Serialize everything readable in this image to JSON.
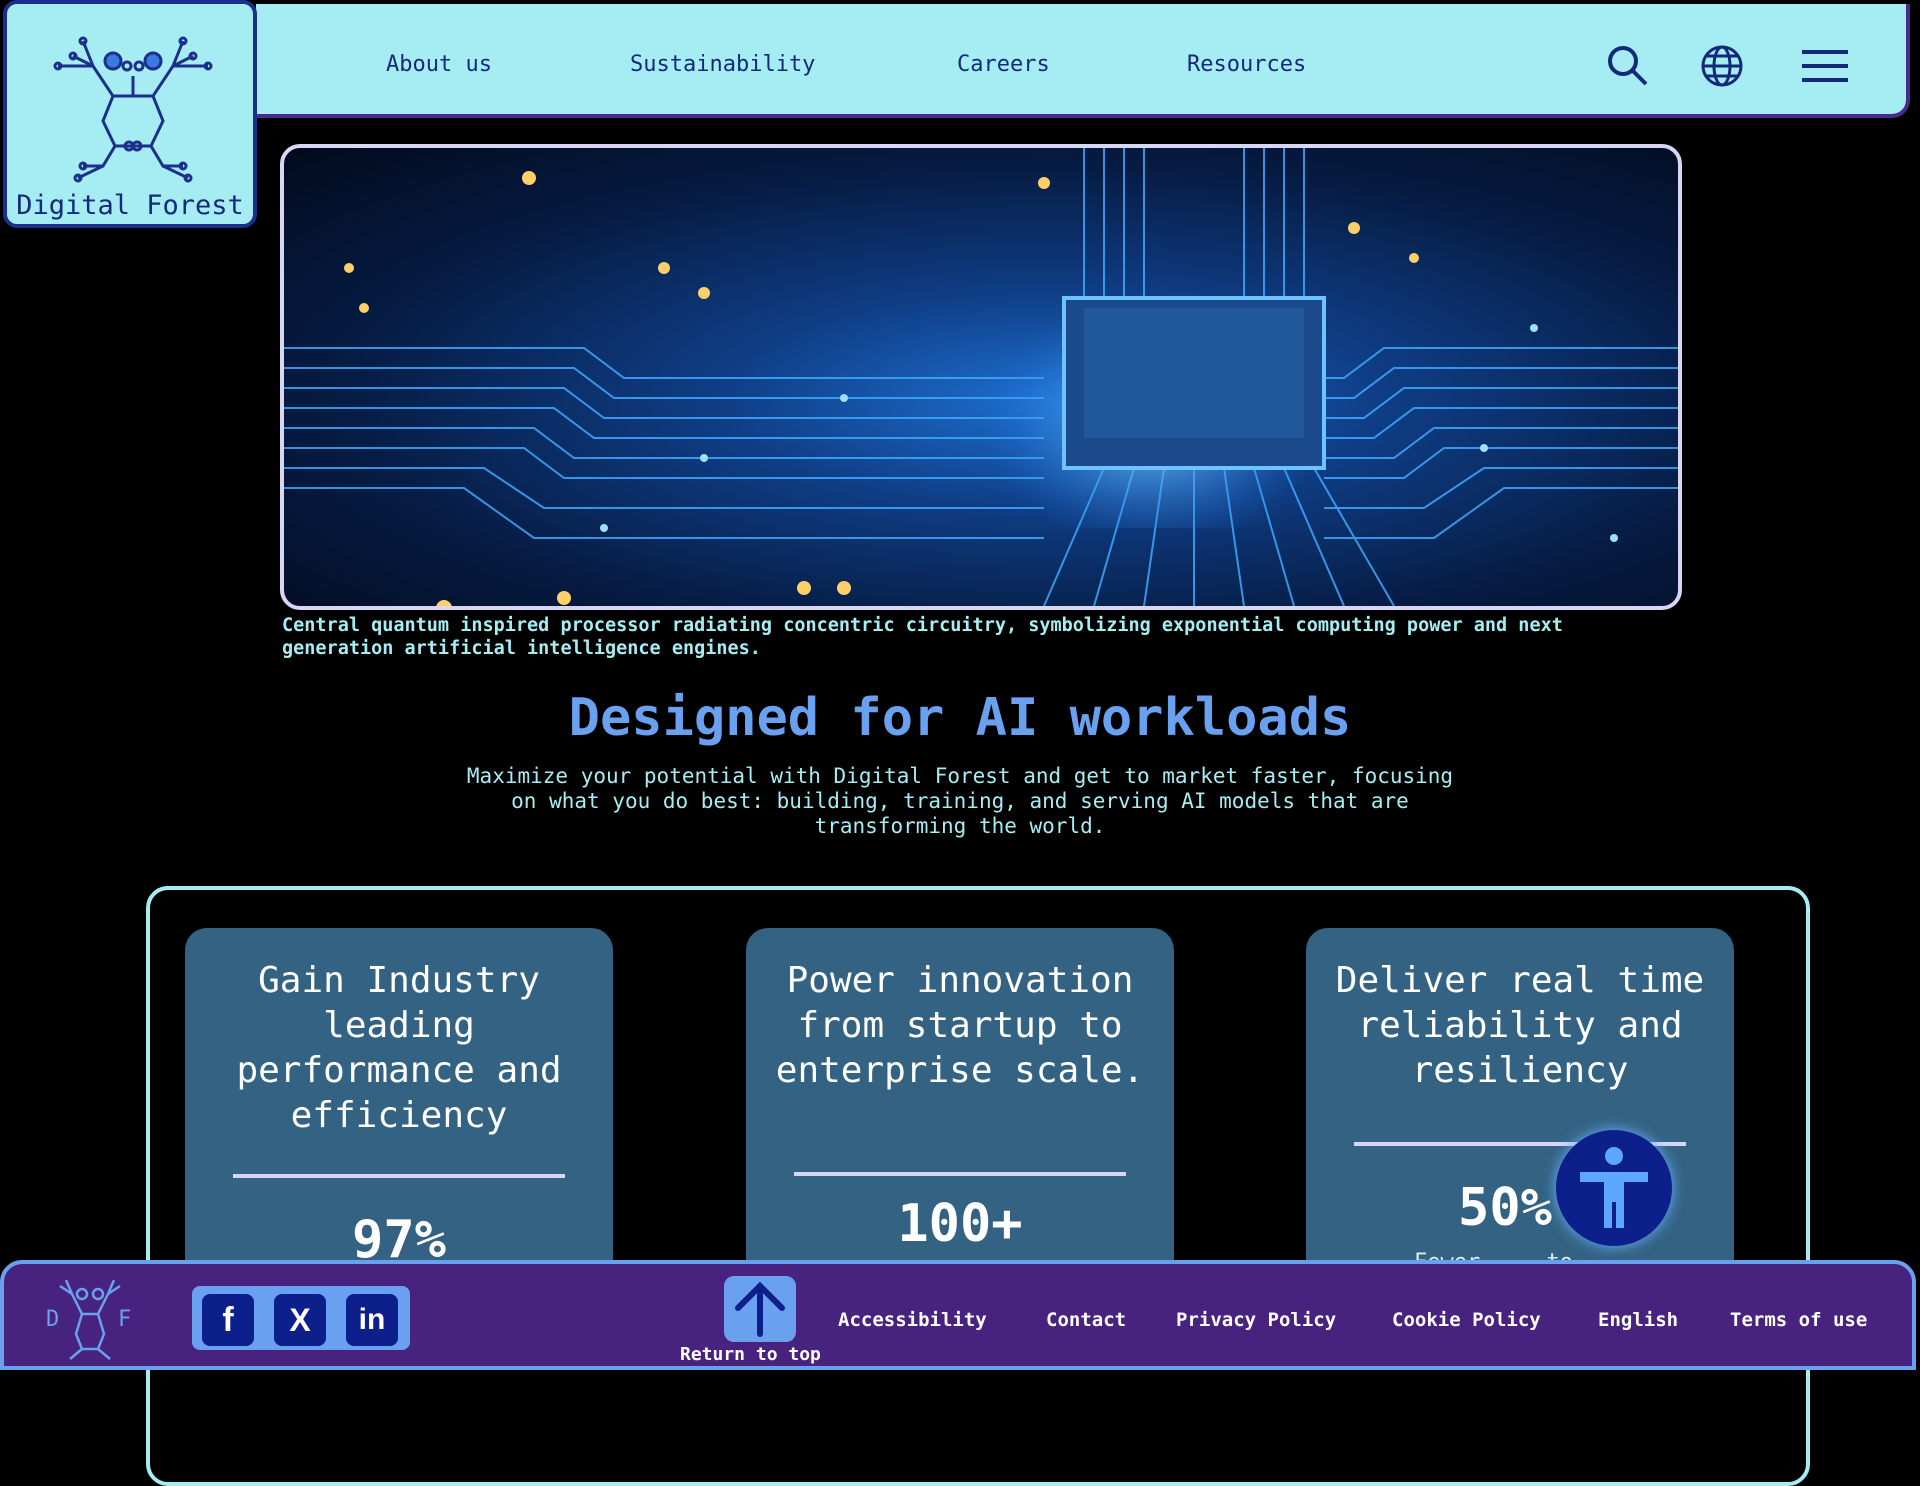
{
  "brand": {
    "name": "Digital Forest",
    "footer_initials": [
      "D",
      "F"
    ]
  },
  "nav": {
    "items": [
      {
        "label": "About us"
      },
      {
        "label": "Sustainability"
      },
      {
        "label": "Careers"
      },
      {
        "label": "Resources"
      }
    ],
    "icons": [
      "search-icon",
      "globe-icon",
      "hamburger-menu-icon"
    ]
  },
  "hero": {
    "image_alt": "circuit-board-processor-image",
    "caption": "Central quantum inspired processor radiating concentric circuitry, symbolizing exponential computing power and next generation artificial intelligence engines."
  },
  "section": {
    "title": "Designed for AI workloads",
    "description": "Maximize your potential with Digital Forest and get to market faster, focusing on what you do best: building, training, and serving AI models that are transforming the world."
  },
  "cards": [
    {
      "title": "Gain Industry leading performance and efficiency",
      "stat": "97%",
      "sub": ""
    },
    {
      "title": "Power innovation from startup to enterprise scale.",
      "stat": "100+",
      "sub": ""
    },
    {
      "title": "Deliver real time reliability and resiliency",
      "stat": "50%",
      "sub": "Fewer ... to ..."
    }
  ],
  "footer": {
    "social": [
      {
        "label": "f",
        "icon": "facebook-icon"
      },
      {
        "label": "X",
        "icon": "x-icon"
      },
      {
        "label": "in",
        "icon": "linkedin-icon"
      }
    ],
    "return_to_top": "Return to top",
    "links": [
      {
        "label": "Accessibility"
      },
      {
        "label": "Contact"
      },
      {
        "label": "Privacy Policy"
      },
      {
        "label": "Cookie Policy"
      },
      {
        "label": "English"
      },
      {
        "label": "Terms of use"
      }
    ]
  },
  "colors": {
    "header_bg": "#a6ecf3",
    "nav_text": "#15297a",
    "accent_blue": "#6aa0f0",
    "card_bg": "#336283",
    "footer_bg": "#48227f",
    "a11y_button": "#0d1f8a"
  }
}
